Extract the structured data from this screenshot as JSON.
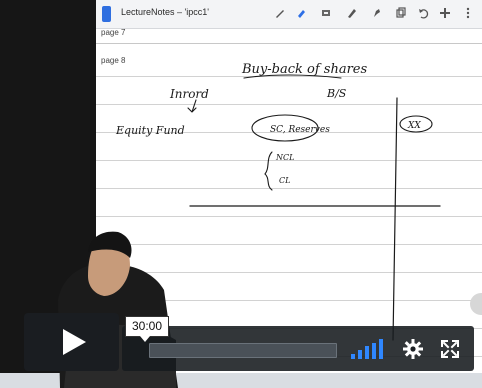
{
  "app": {
    "title": "LectureNotes – 'ipcc1'",
    "pages": [
      {
        "label": "page 7"
      },
      {
        "label": "page 8"
      }
    ],
    "toolbar_icons": [
      "pen-icon",
      "marker-icon",
      "eraser-icon",
      "pencil-icon",
      "highlighter-icon",
      "copy-icon",
      "undo-icon",
      "add-icon",
      "more-icon"
    ]
  },
  "handwriting": {
    "heading": "Buy-back of shares",
    "word_left": "Inrord",
    "balance_sheet": "B/S",
    "equity_side": "Equity Fund",
    "circled_block": "SC, Reserves",
    "ncl": "NCL",
    "cl": "CL",
    "right_circle": "XX"
  },
  "player": {
    "time_tooltip": "30:00",
    "progress": 0.0,
    "volume_level": 0.8,
    "colors": {
      "accent": "#2f87ff",
      "bar_bg": "#161a1e"
    }
  }
}
